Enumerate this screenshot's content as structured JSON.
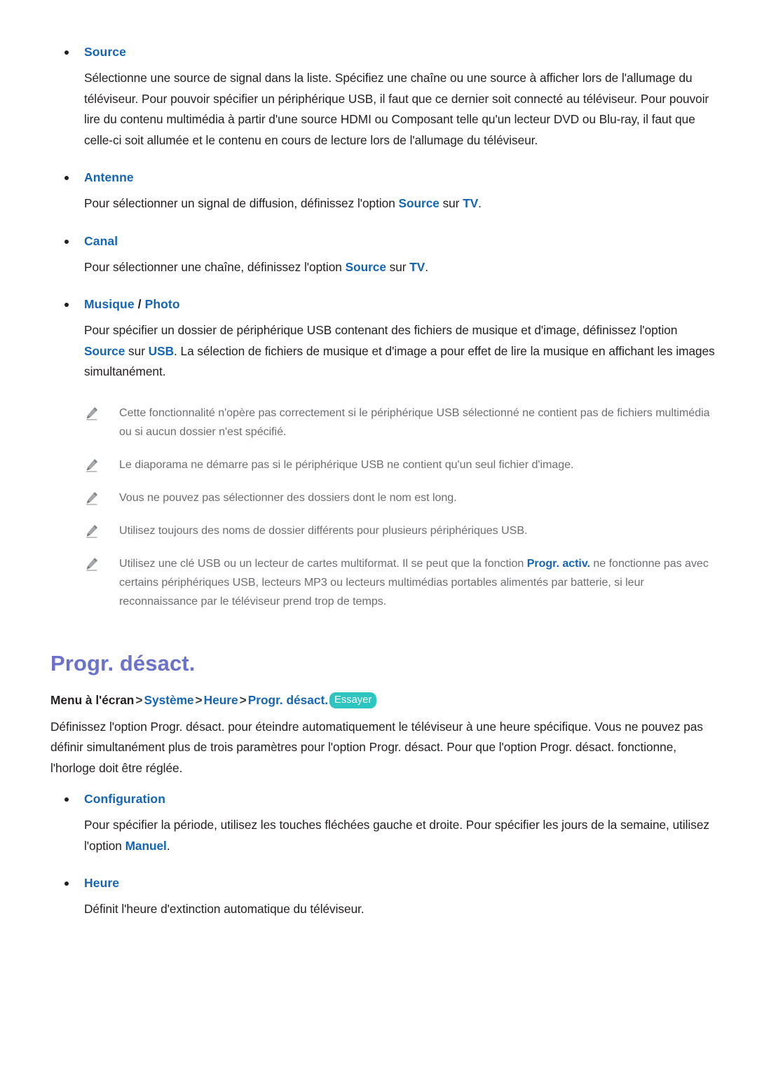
{
  "document": {
    "language": "fr",
    "colors": {
      "accent_blue": "#1565b5",
      "heading_purple": "#6b72c9",
      "badge_teal": "#2ec4c0",
      "body_text": "#231f20",
      "note_text": "#6d6e71"
    }
  },
  "sections": [
    {
      "id": "source",
      "bullet_label": "Source",
      "paragraph": "Sélectionne une source de signal dans la liste. Spécifiez une chaîne ou une source à afficher lors de l'allumage du téléviseur. Pour pouvoir spécifier un périphérique USB, il faut que ce dernier soit connecté au téléviseur. Pour pouvoir lire du contenu multimédia à partir d'une source HDMI ou Composant telle qu'un lecteur DVD ou Blu-ray, il faut que celle-ci soit allumée et le contenu en cours de lecture lors de l'allumage du téléviseur."
    },
    {
      "id": "antenne",
      "bullet_label": "Antenne",
      "para_part1": "Pour sélectionner un signal de diffusion, définissez l'option ",
      "kw1": "Source",
      "para_part2": " sur ",
      "kw2": "TV",
      "para_part3": "."
    },
    {
      "id": "canal",
      "bullet_label": "Canal",
      "para_part1": "Pour sélectionner une chaîne, définissez l'option ",
      "kw1": "Source",
      "para_part2": " sur ",
      "kw2": "TV",
      "para_part3": "."
    },
    {
      "id": "musique-photo",
      "bullet_label_a": "Musique",
      "bullet_separator": " / ",
      "bullet_label_b": "Photo",
      "para_part1": "Pour spécifier un dossier de périphérique USB contenant des fichiers de musique et d'image, définissez l'option ",
      "kw1": "Source",
      "para_part2": " sur ",
      "kw2": "USB",
      "para_part3": ". La sélection de fichiers de musique et d'image a pour effet de lire la musique en affichant les images simultanément."
    }
  ],
  "notes": [
    {
      "icon": "pencil-note-icon",
      "text": "Cette fonctionnalité n'opère pas correctement si le périphérique USB sélectionné ne contient pas de fichiers multimédia ou si aucun dossier n'est spécifié."
    },
    {
      "icon": "pencil-note-icon",
      "text": "Le diaporama ne démarre pas si le périphérique USB ne contient qu'un seul fichier d'image."
    },
    {
      "icon": "pencil-note-icon",
      "text": "Vous ne pouvez pas sélectionner des dossiers dont le nom est long."
    },
    {
      "icon": "pencil-note-icon",
      "text": "Utilisez toujours des noms de dossier différents pour plusieurs périphériques USB."
    },
    {
      "icon": "pencil-note-icon",
      "text_part1": "Utilisez une clé USB ou un lecteur de cartes multiformat. Il se peut que la fonction ",
      "kw1": "Progr. activ.",
      "text_part2": " ne fonctionne pas avec certains périphériques USB, lecteurs MP3 ou lecteurs multimédias portables alimentés par batterie, si leur reconnaissance par le téléviseur prend trop de temps."
    }
  ],
  "progr_desact": {
    "heading": "Progr. désact.",
    "breadcrumb": {
      "root": "Menu à l'écran",
      "separator": ">",
      "link1": "Système",
      "link2": "Heure",
      "link3": "Progr. désact.",
      "badge": "Essayer"
    },
    "paragraph": "Définissez l'option Progr. désact. pour éteindre automatiquement le téléviseur à une heure spécifique. Vous ne pouvez pas définir simultanément plus de trois paramètres pour l'option Progr. désact. Pour que l'option Progr. désact. fonctionne, l'horloge doit être réglée.",
    "items": [
      {
        "id": "configuration",
        "bullet_label": "Configuration",
        "para_part1": "Pour spécifier la période, utilisez les touches fléchées gauche et droite. Pour spécifier les jours de la semaine, utilisez l'option ",
        "kw1": "Manuel",
        "para_part2": "."
      },
      {
        "id": "heure",
        "bullet_label": "Heure",
        "paragraph": "Définit l'heure d'extinction automatique du téléviseur."
      }
    ]
  }
}
